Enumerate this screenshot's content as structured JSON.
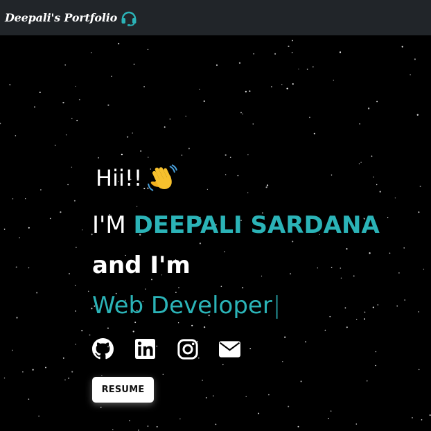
{
  "navbar": {
    "brand": "Deepali's Portfolio",
    "brand_icon": "headset-icon",
    "accent": "#2bb3b7"
  },
  "hero": {
    "greeting": "Hii!!",
    "greeting_icon": "waving-hand-icon",
    "intro_prefix": "I'M",
    "name": "DEEPALI SARDANA",
    "and_line": "and I'm",
    "role": "Web Developer",
    "cursor": "|"
  },
  "socials": [
    {
      "icon": "github-icon"
    },
    {
      "icon": "linkedin-icon"
    },
    {
      "icon": "instagram-icon"
    },
    {
      "icon": "email-icon"
    }
  ],
  "resume_label": "RESUME",
  "colors": {
    "background": "#000000",
    "navbar": "#212529",
    "accent": "#2bb3b7",
    "text": "#ffffff"
  }
}
